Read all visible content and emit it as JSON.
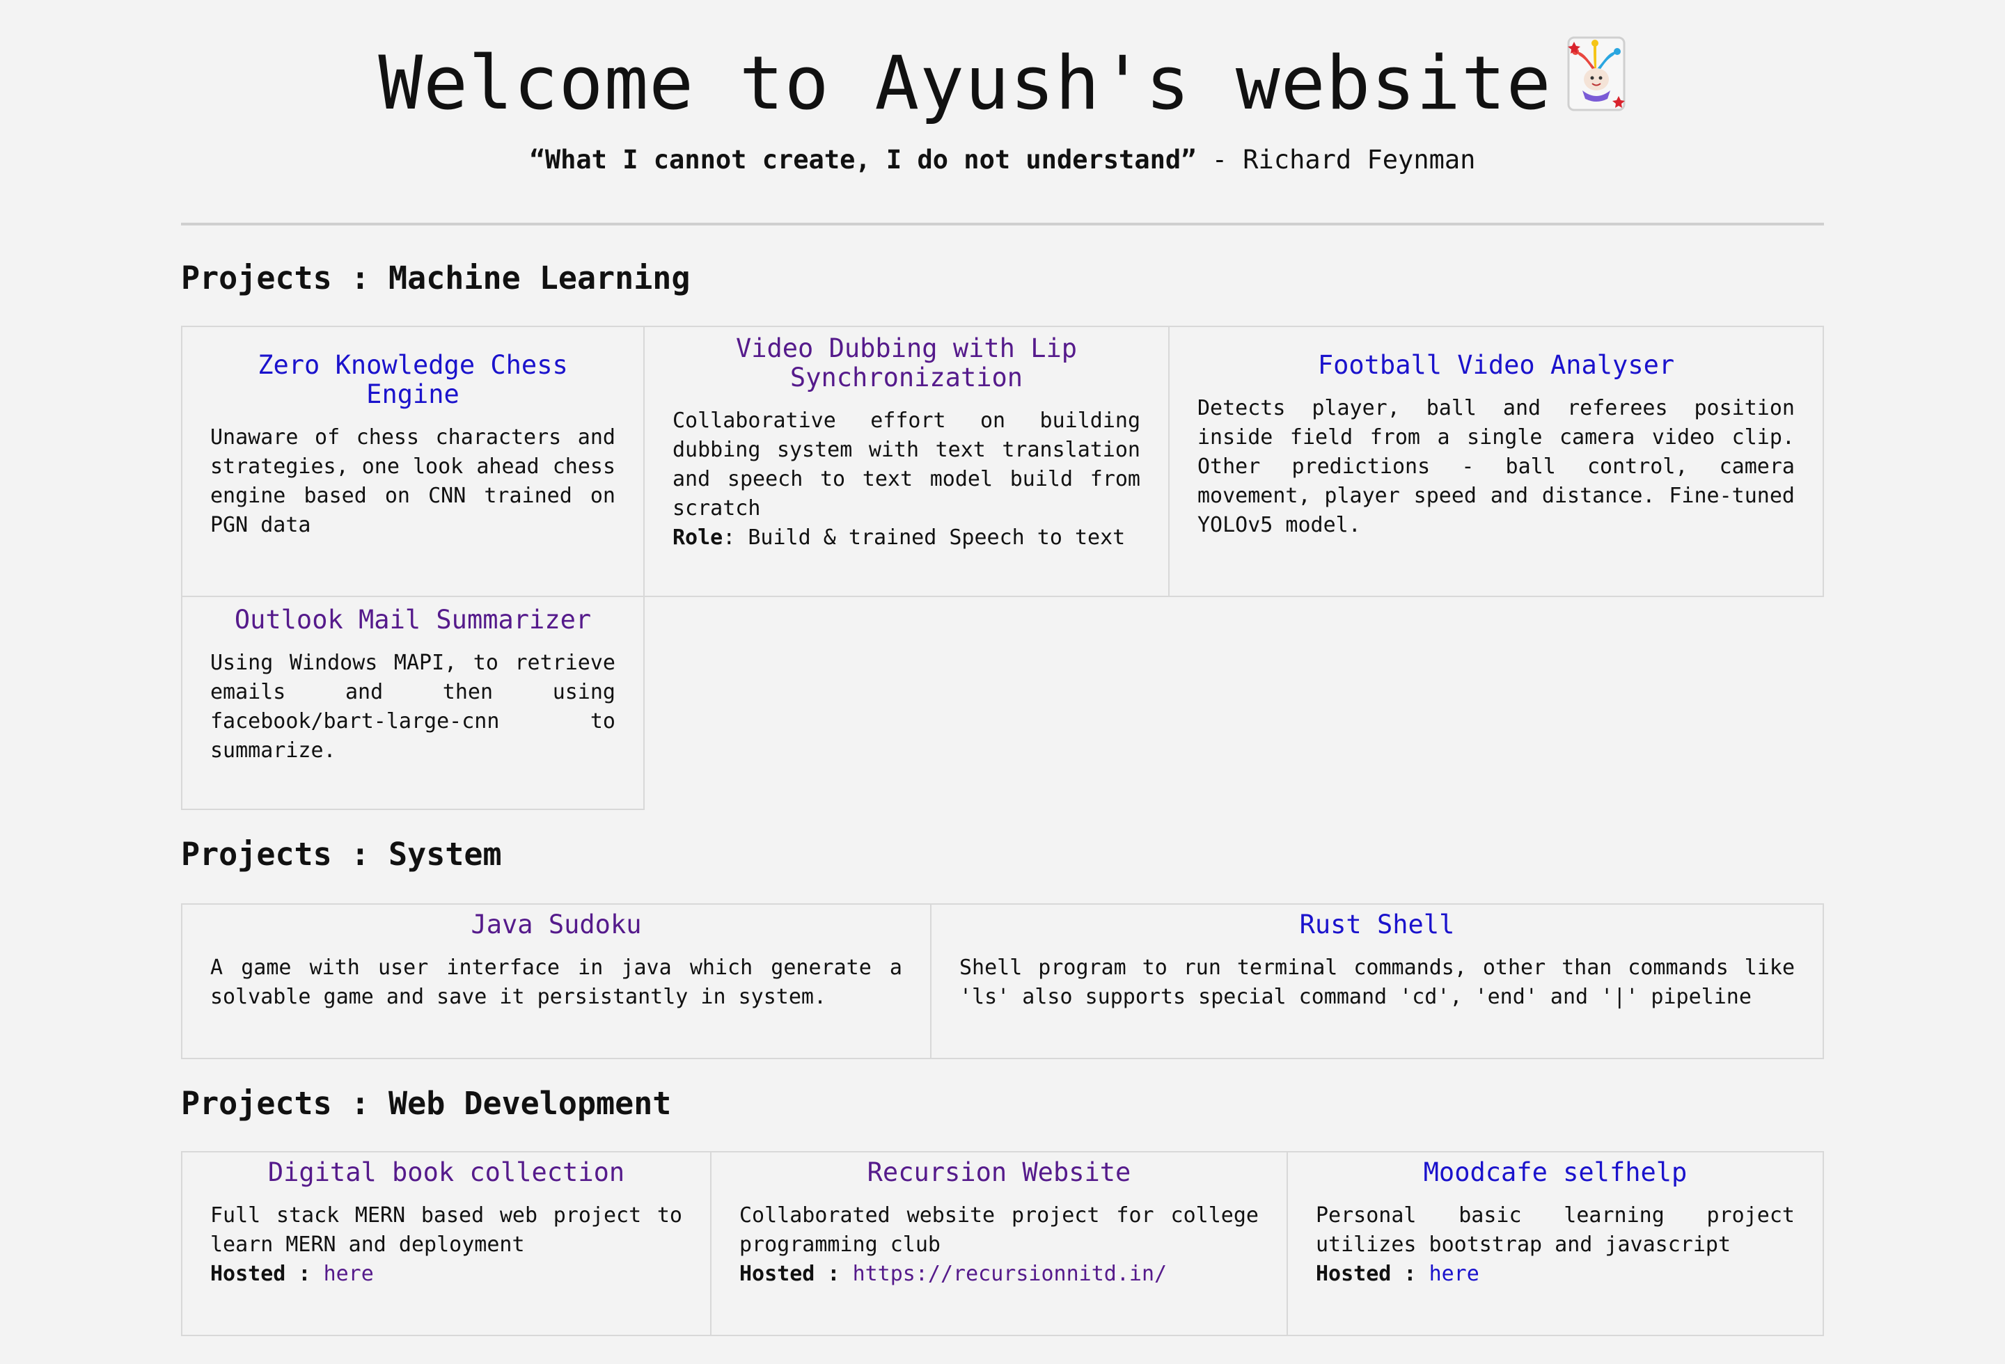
{
  "header": {
    "title": "Welcome to Ayush's website",
    "title_icon": "jester-icon",
    "quote": "“What I cannot create, I do not understand”",
    "quote_separator": " - ",
    "quote_author": "Richard Feynman"
  },
  "sections": {
    "ml": {
      "heading": "Projects : Machine Learning",
      "cards": [
        {
          "title": "Zero Knowledge Chess Engine",
          "description": "Unaware of chess characters and strategies, one look ahead chess engine based on CNN trained on PGN data"
        },
        {
          "title": "Video Dubbing with Lip Synchronization",
          "description": "Collaborative effort on building dubbing system with text translation and speech to text model build from scratch",
          "role_label": "Role",
          "role_value": ": Build & trained Speech to text"
        },
        {
          "title": "Football Video Analyser",
          "description": "Detects player, ball and referees position inside field from a single camera video clip. Other predictions - ball control, camera movement, player speed and distance. Fine-tuned YOLOv5 model."
        },
        {
          "title": "Outlook Mail Summarizer",
          "description": "Using Windows MAPI, to retrieve emails and then using facebook/bart-large-cnn to summarize."
        }
      ]
    },
    "system": {
      "heading": "Projects : System",
      "cards": [
        {
          "title": "Java Sudoku",
          "description": "A game with user interface in java which generate a solvable game and save it persistantly in system."
        },
        {
          "title": "Rust Shell",
          "description": "Shell program to run terminal commands, other than commands like 'ls' also supports special command 'cd', 'end' and '|' pipeline"
        }
      ]
    },
    "web": {
      "heading": "Projects : Web Development",
      "cards": [
        {
          "title": "Digital book collection",
          "description": "Full stack MERN based web project to learn MERN and deployment",
          "hosted_label": "Hosted :",
          "hosted_link": "here"
        },
        {
          "title": "Recursion Website",
          "description": "Collaborated website project for college programming club",
          "hosted_label": "Hosted :",
          "hosted_link": "https://recursionnitd.in/"
        },
        {
          "title": "Moodcafe selfhelp",
          "description": "Personal basic learning project utilizes bootstrap and javascript",
          "hosted_label": "Hosted :",
          "hosted_link": "here"
        }
      ]
    }
  },
  "colors": {
    "background": "#f3f3f3",
    "unvisited_link": "#1a12cc",
    "visited_link": "#551a8b",
    "border": "#d8d8d8"
  }
}
